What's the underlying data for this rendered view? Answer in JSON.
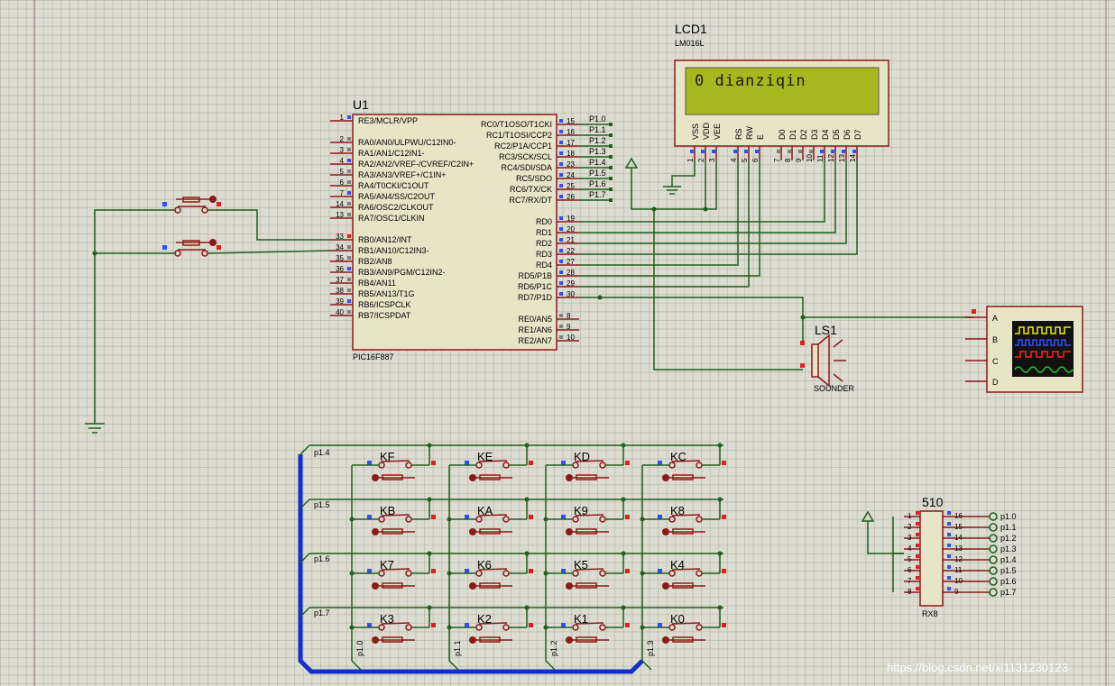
{
  "u1": {
    "ref": "U1",
    "part": "PIC16F887",
    "left_pins": [
      {
        "num": "1",
        "name": "RE3/MCLR/VPP"
      },
      {
        "num": "2",
        "name": "RA0/AN0/ULPWU/C12IN0-"
      },
      {
        "num": "3",
        "name": "RA1/AN1/C12IN1-"
      },
      {
        "num": "4",
        "name": "RA2/AN2/VREF-/CVREF/C2IN+"
      },
      {
        "num": "5",
        "name": "RA3/AN3/VREF+/C1IN+"
      },
      {
        "num": "6",
        "name": "RA4/T0CKI/C1OUT"
      },
      {
        "num": "7",
        "name": "RA5/AN4/SS/C2OUT"
      },
      {
        "num": "14",
        "name": "RA6/OSC2/CLKOUT"
      },
      {
        "num": "13",
        "name": "RA7/OSC1/CLKIN"
      },
      {
        "num": "33",
        "name": "RB0/AN12/INT"
      },
      {
        "num": "34",
        "name": "RB1/AN10/C12IN3-"
      },
      {
        "num": "35",
        "name": "RB2/AN8"
      },
      {
        "num": "36",
        "name": "RB3/AN9/PGM/C12IN2-"
      },
      {
        "num": "37",
        "name": "RB4/AN11"
      },
      {
        "num": "38",
        "name": "RB5/AN13/T1G"
      },
      {
        "num": "39",
        "name": "RB6/ICSPCLK"
      },
      {
        "num": "40",
        "name": "RB7/ICSPDAT"
      }
    ],
    "right_pins": [
      {
        "num": "15",
        "name": "RC0/T1OSO/T1CKI",
        "net": "P1.0"
      },
      {
        "num": "16",
        "name": "RC1/T1OSI/CCP2",
        "net": "P1.1"
      },
      {
        "num": "17",
        "name": "RC2/P1A/CCP1",
        "net": "P1.2"
      },
      {
        "num": "18",
        "name": "RC3/SCK/SCL",
        "net": "P1.3"
      },
      {
        "num": "23",
        "name": "RC4/SDI/SDA",
        "net": "P1.4"
      },
      {
        "num": "24",
        "name": "RC5/SDO",
        "net": "P1.5"
      },
      {
        "num": "25",
        "name": "RC6/TX/CK",
        "net": "P1.6"
      },
      {
        "num": "26",
        "name": "RC7/RX/DT",
        "net": "P1.7"
      },
      {
        "num": "19",
        "name": "RD0",
        "net": ""
      },
      {
        "num": "20",
        "name": "RD1",
        "net": ""
      },
      {
        "num": "21",
        "name": "RD2",
        "net": ""
      },
      {
        "num": "22",
        "name": "RD3",
        "net": ""
      },
      {
        "num": "27",
        "name": "RD4",
        "net": ""
      },
      {
        "num": "28",
        "name": "RD5/P1B",
        "net": ""
      },
      {
        "num": "29",
        "name": "RD6/P1C",
        "net": ""
      },
      {
        "num": "30",
        "name": "RD7/P1D",
        "net": ""
      },
      {
        "num": "8",
        "name": "RE0/AN5",
        "net": ""
      },
      {
        "num": "9",
        "name": "RE1/AN6",
        "net": ""
      },
      {
        "num": "10",
        "name": "RE2/AN7",
        "net": ""
      }
    ]
  },
  "lcd": {
    "ref": "LCD1",
    "part": "LM016L",
    "display_text": "0 dianziqin",
    "pins": [
      {
        "num": "1",
        "name": "VSS"
      },
      {
        "num": "2",
        "name": "VDD"
      },
      {
        "num": "3",
        "name": "VEE"
      },
      {
        "num": "4",
        "name": "RS"
      },
      {
        "num": "5",
        "name": "RW"
      },
      {
        "num": "6",
        "name": "E"
      },
      {
        "num": "7",
        "name": "D0"
      },
      {
        "num": "8",
        "name": "D1"
      },
      {
        "num": "9",
        "name": "D2"
      },
      {
        "num": "10",
        "name": "D3"
      },
      {
        "num": "11",
        "name": "D4"
      },
      {
        "num": "12",
        "name": "D5"
      },
      {
        "num": "13",
        "name": "D6"
      },
      {
        "num": "14",
        "name": "D7"
      }
    ]
  },
  "sounder": {
    "ref": "LS1",
    "part": "SOUNDER"
  },
  "scope": {
    "channels": [
      "A",
      "B",
      "C",
      "D"
    ]
  },
  "rx8": {
    "ref": "510",
    "part": "RX8",
    "left_pins": [
      "1",
      "2",
      "3",
      "4",
      "5",
      "6",
      "7",
      "8"
    ],
    "right_pins": [
      "16",
      "15",
      "14",
      "13",
      "12",
      "11",
      "10",
      "9"
    ],
    "nets": [
      "p1.0",
      "p1.1",
      "p1.2",
      "p1.3",
      "p1.4",
      "p1.5",
      "p1.6",
      "p1.7"
    ]
  },
  "keypad": {
    "rows": [
      {
        "net": "p1.4",
        "keys": [
          "KF",
          "KE",
          "KD",
          "KC"
        ]
      },
      {
        "net": "p1.5",
        "keys": [
          "KB",
          "KA",
          "K9",
          "K8"
        ]
      },
      {
        "net": "p1.6",
        "keys": [
          "K7",
          "K6",
          "K5",
          "K4"
        ]
      },
      {
        "net": "p1.7",
        "keys": [
          "K3",
          "K2",
          "K1",
          "K0"
        ]
      }
    ],
    "col_nets": [
      "p1.0",
      "p1.1",
      "p1.2",
      "p1.3"
    ]
  },
  "watermark": "https://blog.csdn.net/xl1131230123",
  "colors": {
    "wire": "#1f5f1f",
    "component": "#8b1a1a",
    "body_fill": "#e8e4c8",
    "bus": "#1530c8",
    "lcd_screen": "#a6b81e"
  }
}
